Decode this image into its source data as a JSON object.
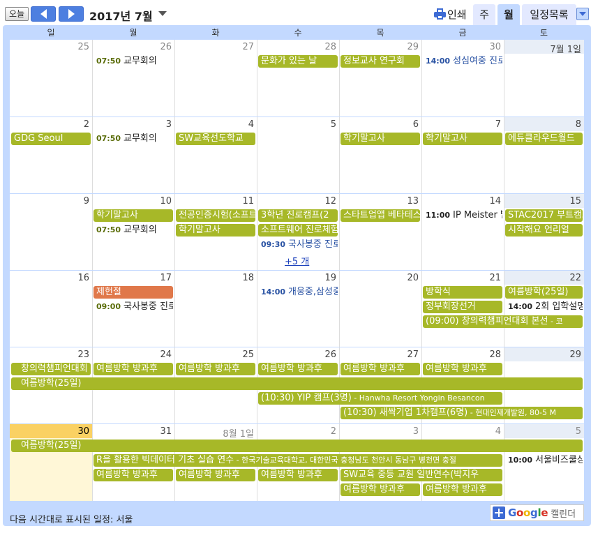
{
  "toolbar": {
    "today_label": "오늘",
    "month_title": "2017년 7월",
    "print_label": "인쇄",
    "view_week": "주",
    "view_month": "월",
    "view_agenda": "일정목록"
  },
  "weekdays": [
    "일",
    "월",
    "화",
    "수",
    "목",
    "금",
    "토"
  ],
  "weeks": [
    {
      "days": [
        "25",
        "26",
        "27",
        "28",
        "29",
        "30",
        "7월 1일"
      ],
      "other_month": [
        true,
        true,
        true,
        true,
        true,
        true,
        false
      ],
      "events": [
        {
          "row": 0,
          "start": 1,
          "span": 1,
          "kind": "txt",
          "time": "07:50",
          "title": "교무회의"
        },
        {
          "row": 0,
          "start": 3,
          "span": 1,
          "kind": "bar",
          "title": "문화가 있는 날"
        },
        {
          "row": 0,
          "start": 4,
          "span": 1,
          "kind": "bar",
          "title": "정보교사 연구회"
        },
        {
          "row": 0,
          "start": 5,
          "span": 1,
          "kind": "txt-blue",
          "time": "14:00",
          "title": "성심여중 진로"
        }
      ]
    },
    {
      "days": [
        "2",
        "3",
        "4",
        "5",
        "6",
        "7",
        "8"
      ],
      "other_month": [
        false,
        false,
        false,
        false,
        false,
        false,
        false
      ],
      "events": [
        {
          "row": 0,
          "start": 0,
          "span": 1,
          "kind": "bar",
          "title": "GDG Seoul"
        },
        {
          "row": 0,
          "start": 1,
          "span": 1,
          "kind": "txt",
          "time": "07:50",
          "title": "교무회의"
        },
        {
          "row": 0,
          "start": 2,
          "span": 1,
          "kind": "bar",
          "title": "SW교육선도학교"
        },
        {
          "row": 0,
          "start": 4,
          "span": 1,
          "kind": "bar",
          "title": "학기말고사"
        },
        {
          "row": 0,
          "start": 5,
          "span": 1,
          "kind": "bar",
          "title": "학기말고사"
        },
        {
          "row": 0,
          "start": 6,
          "span": 1,
          "kind": "bar",
          "title": "에듀클라우드월드"
        }
      ]
    },
    {
      "days": [
        "9",
        "10",
        "11",
        "12",
        "13",
        "14",
        "15"
      ],
      "other_month": [
        false,
        false,
        false,
        false,
        false,
        false,
        false
      ],
      "events": [
        {
          "row": 0,
          "start": 1,
          "span": 1,
          "kind": "bar",
          "title": "학기말고사"
        },
        {
          "row": 0,
          "start": 2,
          "span": 1,
          "kind": "bar",
          "title": "전공인증시험(소프트웨어"
        },
        {
          "row": 0,
          "start": 3,
          "span": 1,
          "kind": "bar",
          "title": "3학년 진로캠프(2"
        },
        {
          "row": 0,
          "start": 4,
          "span": 1,
          "kind": "bar",
          "title": "스타트업앱 베타테스터"
        },
        {
          "row": 0,
          "start": 5,
          "span": 1,
          "kind": "txt-dark",
          "time": "11:00",
          "title": "IP Meister 발"
        },
        {
          "row": 0,
          "start": 6,
          "span": 1,
          "kind": "bar",
          "title": "STAC2017 부트캠프"
        },
        {
          "row": 1,
          "start": 1,
          "span": 1,
          "kind": "txt",
          "time": "07:50",
          "title": "교무회의"
        },
        {
          "row": 1,
          "start": 2,
          "span": 1,
          "kind": "bar",
          "title": "학기말고사"
        },
        {
          "row": 1,
          "start": 3,
          "span": 1,
          "kind": "bar",
          "title": "소프트웨어 진로체험"
        },
        {
          "row": 1,
          "start": 6,
          "span": 1,
          "kind": "bar",
          "title": "시작해요 언리얼"
        },
        {
          "row": 2,
          "start": 3,
          "span": 1,
          "kind": "txt-blue",
          "time": "09:30",
          "title": "국사봉중 진로"
        }
      ],
      "more": {
        "col": 3,
        "label": "+5 개"
      }
    },
    {
      "days": [
        "16",
        "17",
        "18",
        "19",
        "20",
        "21",
        "22"
      ],
      "other_month": [
        false,
        false,
        false,
        false,
        false,
        false,
        false
      ],
      "events": [
        {
          "row": 0,
          "start": 1,
          "span": 1,
          "kind": "bar-red",
          "title": "제헌절"
        },
        {
          "row": 0,
          "start": 3,
          "span": 1,
          "kind": "txt-blue",
          "time": "14:00",
          "title": "개웅중,삼성중"
        },
        {
          "row": 0,
          "start": 5,
          "span": 1,
          "kind": "bar",
          "title": "방학식"
        },
        {
          "row": 0,
          "start": 6,
          "span": 1,
          "kind": "bar",
          "title": "여름방학(25일)"
        },
        {
          "row": 1,
          "start": 1,
          "span": 1,
          "kind": "txt",
          "time": "09:00",
          "title": "국사봉중 진로"
        },
        {
          "row": 1,
          "start": 5,
          "span": 1,
          "kind": "bar",
          "title": "정부회장선거"
        },
        {
          "row": 1,
          "start": 6,
          "span": 1,
          "kind": "txt-dark",
          "time": "14:00",
          "title": "2회 입학설명"
        },
        {
          "row": 2,
          "start": 5,
          "span": 2,
          "kind": "bar",
          "title": "(09:00) 창의력챔피언대회 본선",
          "loc": " - 코"
        }
      ]
    },
    {
      "days": [
        "23",
        "24",
        "25",
        "26",
        "27",
        "28",
        "29"
      ],
      "other_month": [
        false,
        false,
        false,
        false,
        false,
        false,
        false
      ],
      "events": [
        {
          "row": 0,
          "start": 0,
          "span": 1,
          "kind": "bar",
          "title": "창의력챔피언대회 본선",
          "leftcut": true
        },
        {
          "row": 0,
          "start": 1,
          "span": 1,
          "kind": "bar",
          "title": "여름방학 방과후"
        },
        {
          "row": 0,
          "start": 2,
          "span": 1,
          "kind": "bar",
          "title": "여름방학 방과후"
        },
        {
          "row": 0,
          "start": 3,
          "span": 1,
          "kind": "bar",
          "title": "여름방학 방과후"
        },
        {
          "row": 0,
          "start": 4,
          "span": 1,
          "kind": "bar",
          "title": "여름방학 방과후"
        },
        {
          "row": 0,
          "start": 5,
          "span": 1,
          "kind": "bar",
          "title": "여름방학 방과후"
        },
        {
          "row": 1,
          "start": 0,
          "span": 7,
          "kind": "bar",
          "title": "여름방학(25일)",
          "leftcut": true
        },
        {
          "row": 2,
          "start": 3,
          "span": 3,
          "kind": "bar",
          "title": "(10:30) YIP 캠프(3명)",
          "loc": " - Hanwha Resort Yongin Besancon"
        },
        {
          "row": 3,
          "start": 4,
          "span": 3,
          "kind": "bar",
          "title": "(10:30) 새싹기업 1차캠프(6명)",
          "loc": " - 현대인재개발원, 80-5 M"
        }
      ]
    },
    {
      "days": [
        "30",
        "31",
        "8월 1일",
        "2",
        "3",
        "4",
        "5"
      ],
      "other_month": [
        false,
        false,
        true,
        true,
        true,
        true,
        true
      ],
      "today_col": 0,
      "events": [
        {
          "row": 0,
          "start": 0,
          "span": 7,
          "kind": "bar",
          "title": "여름방학(25일)",
          "leftcut": true
        },
        {
          "row": 1,
          "start": 1,
          "span": 5,
          "kind": "bar",
          "title": "R을 활용한 빅데이터 기초 실습 연수",
          "loc": " - 한국기술교육대학교, 대한민국 충청남도 천안시 동남구 병천면 충절"
        },
        {
          "row": 1,
          "start": 6,
          "span": 1,
          "kind": "txt-dark",
          "time": "10:00",
          "title": "서울비즈쿨상"
        },
        {
          "row": 2,
          "start": 1,
          "span": 1,
          "kind": "bar",
          "title": "여름방학 방과후"
        },
        {
          "row": 2,
          "start": 2,
          "span": 1,
          "kind": "bar",
          "title": "여름방학 방과후"
        },
        {
          "row": 2,
          "start": 3,
          "span": 1,
          "kind": "bar",
          "title": "여름방학 방과후"
        },
        {
          "row": 2,
          "start": 4,
          "span": 2,
          "kind": "bar",
          "title": "SW교육 중등 교원 일반연수(박지우"
        },
        {
          "row": 3,
          "start": 4,
          "span": 1,
          "kind": "bar",
          "title": "여름방학 방과후"
        },
        {
          "row": 3,
          "start": 5,
          "span": 1,
          "kind": "bar",
          "title": "여름방학 방과후"
        }
      ]
    }
  ],
  "footer": {
    "timezone_text": "다음 시간대로 표시된 일정: 서울",
    "gcal_google": "Google",
    "gcal_word": "캘린더"
  }
}
